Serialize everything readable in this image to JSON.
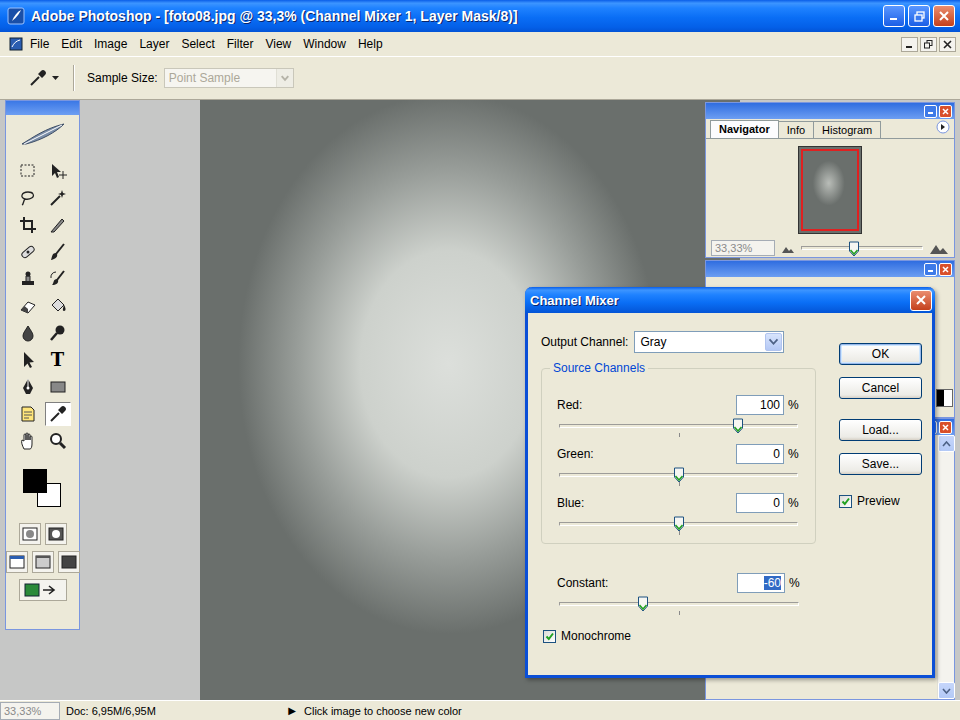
{
  "window": {
    "title": "Adobe Photoshop - [foto08.jpg @ 33,3% (Channel Mixer 1, Layer Mask/8)]"
  },
  "menu": [
    "File",
    "Edit",
    "Image",
    "Layer",
    "Select",
    "Filter",
    "View",
    "Window",
    "Help"
  ],
  "options_bar": {
    "label": "Sample Size:",
    "value": "Point Sample",
    "disabled": true
  },
  "toolbox": {
    "tools": [
      {
        "selected": false
      },
      {
        "selected": false
      },
      {
        "selected": false
      },
      {
        "selected": false
      },
      {
        "selected": false
      },
      {
        "selected": false
      },
      {
        "selected": false
      },
      {
        "selected": false
      },
      {
        "selected": false
      },
      {
        "selected": false
      },
      {
        "selected": false
      },
      {
        "selected": false
      },
      {
        "selected": false
      },
      {
        "selected": false
      },
      {
        "selected": false
      },
      {
        "selected": false
      },
      {
        "selected": false
      },
      {
        "selected": false
      },
      {
        "selected": false
      },
      {
        "selected": true
      },
      {
        "selected": false
      },
      {
        "selected": false
      }
    ],
    "type_glyph": "T",
    "foreground_color": "#000000",
    "background_color": "#ffffff"
  },
  "navigator": {
    "tabs": [
      {
        "label": "Navigator",
        "selected": true
      },
      {
        "label": "Info",
        "selected": false
      },
      {
        "label": "Histogram",
        "selected": false
      }
    ],
    "zoom": "33,33%",
    "zoom_level": 0.43
  },
  "dialog": {
    "title": "Channel Mixer",
    "output_label": "Output Channel:",
    "output_value": "Gray",
    "group_label": "Source Channels",
    "channels": [
      {
        "name": "Red:",
        "value": "100",
        "unit": "%",
        "level": 0.75
      },
      {
        "name": "Green:",
        "value": "0",
        "unit": "%",
        "level": 0.5
      },
      {
        "name": "Blue:",
        "value": "0",
        "unit": "%",
        "level": 0.5
      }
    ],
    "constant": {
      "name": "Constant:",
      "value": "-60",
      "unit": "%",
      "level": 0.35,
      "selected": true
    },
    "buttons": [
      {
        "label": "OK",
        "default": true
      },
      {
        "label": "Cancel",
        "default": false
      },
      {
        "label": "Load...",
        "default": false
      },
      {
        "label": "Save...",
        "default": false
      }
    ],
    "preview": {
      "label": "Preview",
      "checked": true
    },
    "monochrome": {
      "label": "Monochrome",
      "checked": true
    }
  },
  "status_bar": {
    "zoom": "33,33%",
    "doc": "Doc: 6,95M/6,95M",
    "arrow": "▶",
    "hint": "Click image to choose new color"
  }
}
